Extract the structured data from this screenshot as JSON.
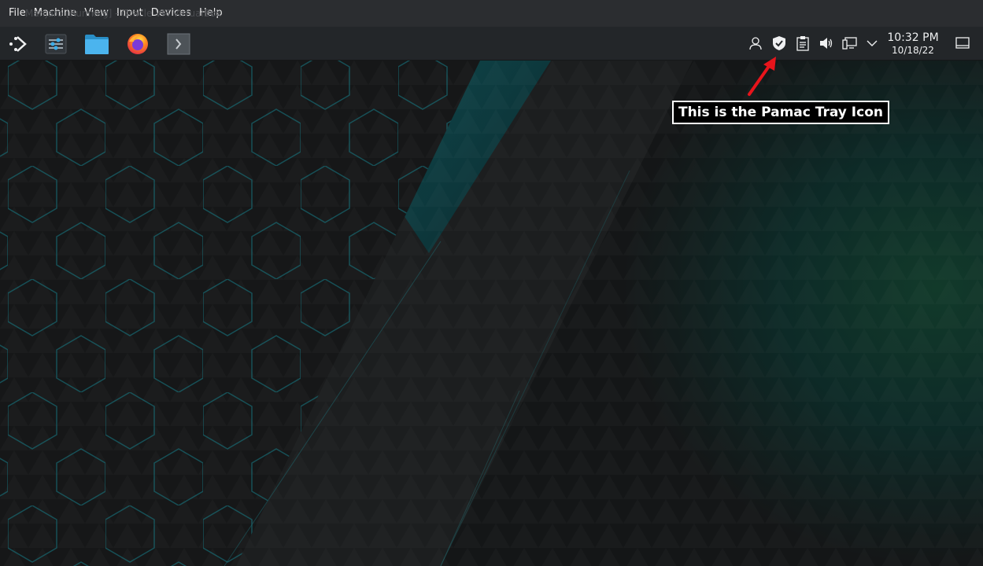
{
  "vm_menubar": {
    "menus": [
      "File",
      "Machine",
      "View",
      "Input",
      "Devices",
      "Help"
    ],
    "background_title": "Manjaro [Running] - Oracle VM VirtualBox"
  },
  "panel": {
    "launcher_icons": [
      {
        "name": "application-launcher-icon"
      },
      {
        "name": "system-settings-icon"
      },
      {
        "name": "file-manager-folder-icon"
      },
      {
        "name": "firefox-icon"
      },
      {
        "name": "terminal-icon"
      }
    ],
    "tray_icons": [
      {
        "name": "user-icon"
      },
      {
        "name": "pamac-shield-icon"
      },
      {
        "name": "clipboard-icon"
      },
      {
        "name": "volume-icon"
      },
      {
        "name": "network-icon"
      },
      {
        "name": "chevron-down-icon"
      }
    ],
    "clock": {
      "time": "10:32 PM",
      "date": "10/18/22"
    },
    "show_desktop_icon": "show-desktop-icon"
  },
  "annotation": {
    "text": "This is the Pamac Tray Icon",
    "arrow_color": "#e8141b"
  },
  "colors": {
    "panel_bg": "#232629",
    "menubar_bg": "#2b2d30",
    "hex_accent": "#1a8a9a",
    "folder_blue": "#3daee9"
  }
}
